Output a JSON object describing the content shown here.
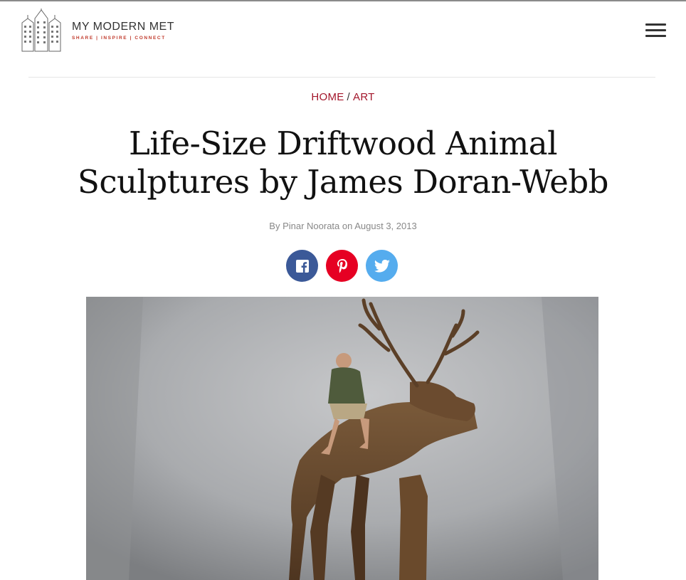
{
  "site": {
    "name": "MY MODERN MET",
    "tagline": "SHARE | INSPIRE | CONNECT",
    "logo_icon": "city-buildings-logo",
    "menu_icon": "hamburger-menu-icon"
  },
  "breadcrumb": {
    "items": [
      "HOME",
      "ART"
    ],
    "separator": "/"
  },
  "article": {
    "title": "Life-Size Driftwood Animal Sculptures by James Doran-Webb",
    "byline": "By Pinar Noorata on August 3, 2013"
  },
  "share": [
    {
      "network": "facebook",
      "icon": "facebook-icon",
      "color": "#3b5998"
    },
    {
      "network": "pinterest",
      "icon": "pinterest-icon",
      "color": "#e60023"
    },
    {
      "network": "twitter",
      "icon": "twitter-icon",
      "color": "#55acee"
    }
  ],
  "colors": {
    "accent": "#a3162b",
    "divider": "#e6e6e6"
  }
}
